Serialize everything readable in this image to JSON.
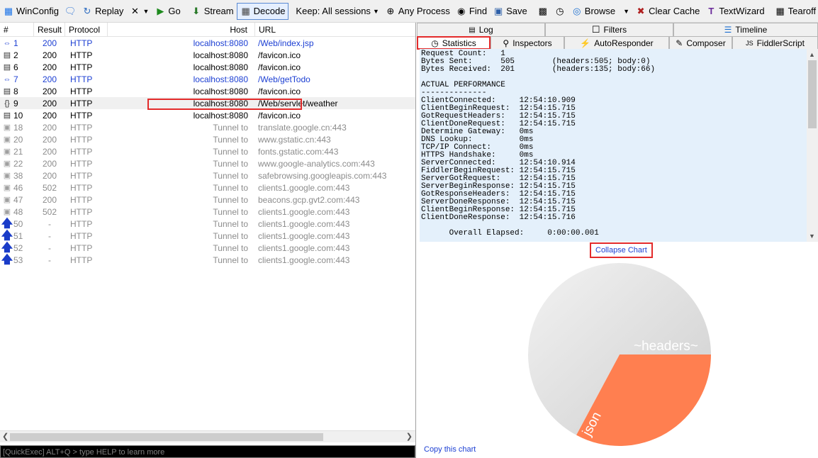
{
  "toolbar": {
    "winconfig": "WinConfig",
    "replay": "Replay",
    "go": "Go",
    "stream": "Stream",
    "decode": "Decode",
    "keep": "Keep: All sessions",
    "any_process": "Any Process",
    "find": "Find",
    "save": "Save",
    "browse": "Browse",
    "clear_cache": "Clear Cache",
    "textwizard": "TextWizard",
    "tearoff": "Tearoff"
  },
  "sessions": {
    "headers": {
      "num": "#",
      "result": "Result",
      "protocol": "Protocol",
      "host": "Host",
      "url": "URL"
    },
    "rows": [
      {
        "num": "1",
        "result": "200",
        "protocol": "HTTP",
        "host": "localhost:8080",
        "url": "/Web/index.jsp",
        "icon": "arrows-icon",
        "style": "blue"
      },
      {
        "num": "2",
        "result": "200",
        "protocol": "HTTP",
        "host": "localhost:8080",
        "url": "/favicon.ico",
        "icon": "document-icon",
        "style": "normal"
      },
      {
        "num": "6",
        "result": "200",
        "protocol": "HTTP",
        "host": "localhost:8080",
        "url": "/favicon.ico",
        "icon": "document-icon",
        "style": "normal"
      },
      {
        "num": "7",
        "result": "200",
        "protocol": "HTTP",
        "host": "localhost:8080",
        "url": "/Web/getTodo",
        "icon": "arrows-icon",
        "style": "blue"
      },
      {
        "num": "8",
        "result": "200",
        "protocol": "HTTP",
        "host": "localhost:8080",
        "url": "/favicon.ico",
        "icon": "document-icon",
        "style": "normal"
      },
      {
        "num": "9",
        "result": "200",
        "protocol": "HTTP",
        "host": "localhost:8080",
        "url": "/Web/servlet/weather",
        "icon": "json-icon",
        "style": "normal"
      },
      {
        "num": "10",
        "result": "200",
        "protocol": "HTTP",
        "host": "localhost:8080",
        "url": "/favicon.ico",
        "icon": "document-icon",
        "style": "normal"
      },
      {
        "num": "18",
        "result": "200",
        "protocol": "HTTP",
        "host": "Tunnel to",
        "url": "translate.google.cn:443",
        "icon": "lock-icon",
        "style": "gray"
      },
      {
        "num": "20",
        "result": "200",
        "protocol": "HTTP",
        "host": "Tunnel to",
        "url": "www.gstatic.cn:443",
        "icon": "lock-icon",
        "style": "gray"
      },
      {
        "num": "21",
        "result": "200",
        "protocol": "HTTP",
        "host": "Tunnel to",
        "url": "fonts.gstatic.com:443",
        "icon": "lock-icon",
        "style": "gray"
      },
      {
        "num": "22",
        "result": "200",
        "protocol": "HTTP",
        "host": "Tunnel to",
        "url": "www.google-analytics.com:443",
        "icon": "lock-icon",
        "style": "gray"
      },
      {
        "num": "38",
        "result": "200",
        "protocol": "HTTP",
        "host": "Tunnel to",
        "url": "safebrowsing.googleapis.com:443",
        "icon": "lock-icon",
        "style": "gray"
      },
      {
        "num": "46",
        "result": "502",
        "protocol": "HTTP",
        "host": "Tunnel to",
        "url": "clients1.google.com:443",
        "icon": "lock-icon",
        "style": "gray"
      },
      {
        "num": "47",
        "result": "200",
        "protocol": "HTTP",
        "host": "Tunnel to",
        "url": "beacons.gcp.gvt2.com:443",
        "icon": "lock-icon",
        "style": "gray"
      },
      {
        "num": "48",
        "result": "502",
        "protocol": "HTTP",
        "host": "Tunnel to",
        "url": "clients1.google.com:443",
        "icon": "lock-icon",
        "style": "gray"
      },
      {
        "num": "50",
        "result": "-",
        "protocol": "HTTP",
        "host": "Tunnel to",
        "url": "clients1.google.com:443",
        "icon": "up-arrow-icon",
        "style": "gray"
      },
      {
        "num": "51",
        "result": "-",
        "protocol": "HTTP",
        "host": "Tunnel to",
        "url": "clients1.google.com:443",
        "icon": "up-arrow-icon",
        "style": "gray"
      },
      {
        "num": "52",
        "result": "-",
        "protocol": "HTTP",
        "host": "Tunnel to",
        "url": "clients1.google.com:443",
        "icon": "up-arrow-icon",
        "style": "gray"
      },
      {
        "num": "53",
        "result": "-",
        "protocol": "HTTP",
        "host": "Tunnel to",
        "url": "clients1.google.com:443",
        "icon": "up-arrow-icon",
        "style": "gray"
      }
    ]
  },
  "quickexec": "[QuickExec] ALT+Q > type HELP to learn more",
  "tabs": {
    "row1": [
      "Log",
      "Filters",
      "Timeline"
    ],
    "row2": [
      "Statistics",
      "Inspectors",
      "AutoResponder",
      "Composer",
      "FiddlerScript"
    ]
  },
  "statistics": {
    "lines": [
      "Request Count:   1",
      "Bytes Sent:      505        (headers:505; body:0)",
      "Bytes Received:  201        (headers:135; body:66)",
      "",
      "ACTUAL PERFORMANCE",
      "--------------",
      "ClientConnected:     12:54:10.909",
      "ClientBeginRequest:  12:54:15.715",
      "GotRequestHeaders:   12:54:15.715",
      "ClientDoneRequest:   12:54:15.715",
      "Determine Gateway:   0ms",
      "DNS Lookup:          0ms",
      "TCP/IP Connect:      0ms",
      "HTTPS Handshake:     0ms",
      "ServerConnected:     12:54:10.914",
      "FiddlerBeginRequest: 12:54:15.715",
      "ServerGotRequest:    12:54:15.715",
      "ServerBeginResponse: 12:54:15.715",
      "GotResponseHeaders:  12:54:15.715",
      "ServerDoneResponse:  12:54:15.715",
      "ClientBeginResponse: 12:54:15.715",
      "ClientDoneResponse:  12:54:15.716",
      "",
      "      Overall Elapsed:     0:00:00.001"
    ]
  },
  "collapse_chart": "Collapse Chart",
  "copy_chart": "Copy this chart",
  "chart_data": {
    "type": "pie",
    "labels": [
      "~headers~",
      "json"
    ],
    "values": [
      135,
      66
    ],
    "colors": [
      "#dcdcdc",
      "#ff7f50"
    ]
  }
}
